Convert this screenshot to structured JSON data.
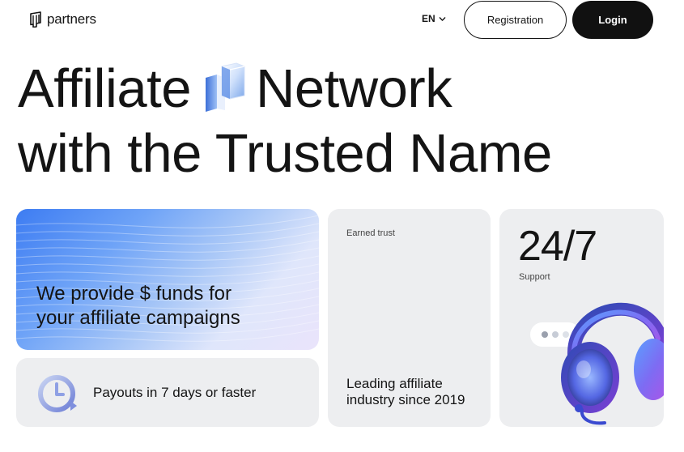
{
  "header": {
    "logo_text": "partners",
    "lang": "EN",
    "registration_label": "Registration",
    "login_label": "Login"
  },
  "hero": {
    "line1_before": "Affiliate",
    "line1_after": "Network",
    "line2": "with the Trusted Name"
  },
  "cards": {
    "funds": {
      "text_line1": "We provide $ funds for",
      "text_line2": "your affiliate campaigns"
    },
    "payouts": {
      "text": "Payouts in 7 days or faster"
    },
    "trust": {
      "label": "Earned trust",
      "text_line1": "Leading affiliate",
      "text_line2": "industry since 2019"
    },
    "support": {
      "big": "24/7",
      "label": "Support"
    }
  },
  "icons": {
    "logo": "partners-logo-icon",
    "lang_chevron": "chevron-down-icon",
    "hero": "3d-block-icon",
    "clock": "clock-refresh-icon",
    "headphones": "headphones-icon"
  },
  "colors": {
    "text": "#141414",
    "login_bg": "#111111",
    "card_bg": "#edeef0",
    "accent_blue": "#3d7cf2",
    "accent_purple": "#8a5cf6"
  }
}
